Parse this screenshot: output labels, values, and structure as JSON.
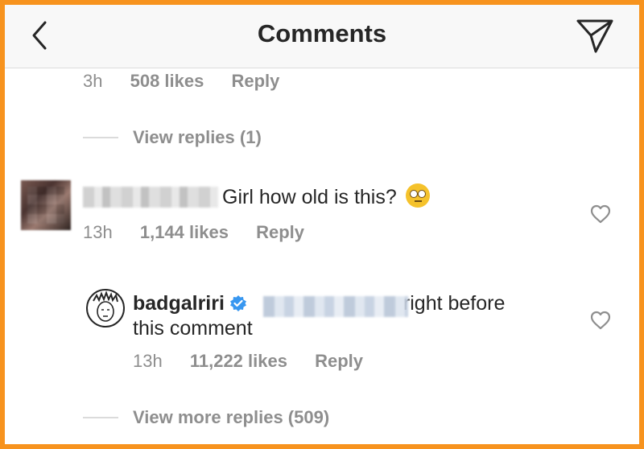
{
  "header": {
    "title": "Comments"
  },
  "first_comment": {
    "time": "3h",
    "likes": "508 likes",
    "reply": "Reply"
  },
  "view_replies_1": "View replies (1)",
  "second_comment": {
    "text": "Girl how old is this?",
    "emoji": "face-with-rolling-eyes",
    "time": "13h",
    "likes": "1,144 likes",
    "reply": "Reply"
  },
  "reply_comment": {
    "username": "badgalriri",
    "text_line1": "right before",
    "text_line2": "this comment",
    "time": "13h",
    "likes": "11,222 likes",
    "reply": "Reply"
  },
  "view_more_replies": "View more replies (509)",
  "colors": {
    "border": "#f7931e",
    "verified": "#3897f0",
    "meta": "#8e8e8e"
  }
}
